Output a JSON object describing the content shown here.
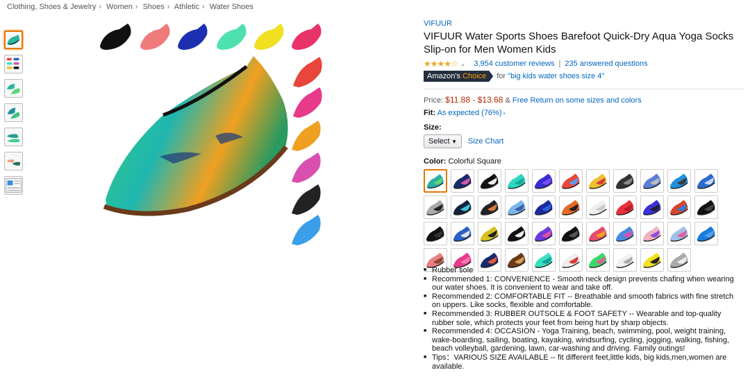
{
  "breadcrumb": [
    "Clothing, Shoes & Jewelry",
    "Women",
    "Shoes",
    "Athletic",
    "Water Shoes"
  ],
  "breadcrumb_separator": "›",
  "colors": {
    "link": "#0066c0",
    "price": "#b12704",
    "star": "#f0a41e",
    "badge_bg": "#232f3e",
    "badge_accent": "#ff9900",
    "selected_outline": "#e77600"
  },
  "product": {
    "brand": "VIFUUR",
    "title": "VIFUUR Water Sports Shoes Barefoot Quick-Dry Aqua Yoga Socks Slip-on for Men Women Kids",
    "rating_stars": 4.5,
    "stars_text": "★★★★☆",
    "reviews": "3,954 customer reviews",
    "separator": "|",
    "answered": "235 answered questions",
    "choice_badge_1": "Amazon's",
    "choice_badge_2": "Choice",
    "choice_for": "for",
    "choice_query": "\"big kids water shoes size 4\"",
    "price_label": "Price:",
    "price_range": "$11.88 - $13.68",
    "price_amp": "&",
    "free_return": "Free Return on some sizes and colors",
    "fit_label": "Fit:",
    "fit_value": "As expected (76%)",
    "size_label": "Size:",
    "size_select": "Select",
    "size_chart": "Size Chart",
    "color_label": "Color:",
    "color_value": "Colorful Square"
  },
  "thumbnail_icons": [
    "shoe-thumb-icon",
    "multi-color-shoes-icon",
    "shoe-pair-icon",
    "shoe-pair-icon",
    "shoe-pair-icon",
    "shoe-with-foot-icon",
    "size-chart-icon"
  ],
  "main_image_icon": "aqua-shoe-photo-icon",
  "swatch_colors": [
    [
      "#2bb0a0",
      "#5bd67a"
    ],
    [
      "#1b2a6b",
      "#d05aa8"
    ],
    [
      "#111",
      "#eee"
    ],
    [
      "#2cd6c0",
      "#1aa89b"
    ],
    [
      "#3a2bd4",
      "#7b4df0"
    ],
    [
      "#e8453c",
      "#5a9de8"
    ],
    [
      "#f0c030",
      "#d93d3d"
    ],
    [
      "#333",
      "#888"
    ],
    [
      "#5a7fd8",
      "#bbb"
    ],
    [
      "#1f8fe0",
      "#3a3a3a"
    ],
    [
      "#2d6ad0",
      "#c9d8ee"
    ],
    [
      "#aaa",
      "#222"
    ],
    [
      "#15203d",
      "#39c6d6"
    ],
    [
      "#222",
      "#d57a3c"
    ],
    [
      "#7ab7e8",
      "#3c5fa8"
    ],
    [
      "#1a2aa0",
      "#2f5ed8"
    ],
    [
      "#e86a22",
      "#222"
    ],
    [
      "#eee",
      "#ccc"
    ],
    [
      "#e8323c",
      "#b81f28"
    ],
    [
      "#3a2fd8",
      "#222"
    ],
    [
      "#d8442f",
      "#2a7fd8"
    ],
    [
      "#111",
      "#444"
    ],
    [
      "#111",
      "#333"
    ],
    [
      "#2a5fc8",
      "#e2e2e2"
    ],
    [
      "#d8c020",
      "#222"
    ],
    [
      "#111",
      "#eee"
    ],
    [
      "#6a3be0",
      "#e84fa0"
    ],
    [
      "#111",
      "#555"
    ],
    [
      "#e84a6a",
      "#f0a020"
    ],
    [
      "#4a8be0",
      "#d84fb0"
    ],
    [
      "#f0b0c0",
      "#8a4fd8"
    ],
    [
      "#9fc0e8",
      "#e85a9a"
    ],
    [
      "#1a7ae0",
      "#4fa0e8"
    ],
    [
      "#e88080",
      "#8a4a3a"
    ],
    [
      "#e83a8a",
      "#f07ab0"
    ],
    [
      "#1a2a6a",
      "#e05a3a"
    ],
    [
      "#6a3a1a",
      "#d8a060"
    ],
    [
      "#3ae0c0",
      "#1a9a9a"
    ],
    [
      "#eee",
      "#d83a3a"
    ],
    [
      "#3ad86a",
      "#e85a9a"
    ],
    [
      "#f0f0f0",
      "#aaa"
    ],
    [
      "#f0e020",
      "#222"
    ],
    [
      "#aaa",
      "#eee"
    ]
  ],
  "bullets": [
    "Rubber sole",
    "Recommended 1: CONVENIENCE - Smooth neck design prevents chafing when wearing our water shoes. It is convenient to wear and take off.",
    "Recommended 2: COMFORTABLE FIT -- Breathable and smooth fabrics with fine stretch on uppers. Like socks, flexible and comfortable.",
    "Recommended 3: RUBBER OUTSOLE & FOOT SAFETY -- Wearable and top-quality rubber sole, which protects your feet from being hurt by sharp objects.",
    "Recommended 4: OCCASION - Yoga Training, beach, swimming, pool, weight training, wake-boarding, sailing, boating, kayaking, windsurfing, cycling, jogging, walking, fishing, beach volleyball, gardening, lawn, car-washing and driving. Family outings!",
    "Tips：VARIOUS SIZE AVAILABLE -- fit different feet,little kids, big kids,men,women are available."
  ]
}
